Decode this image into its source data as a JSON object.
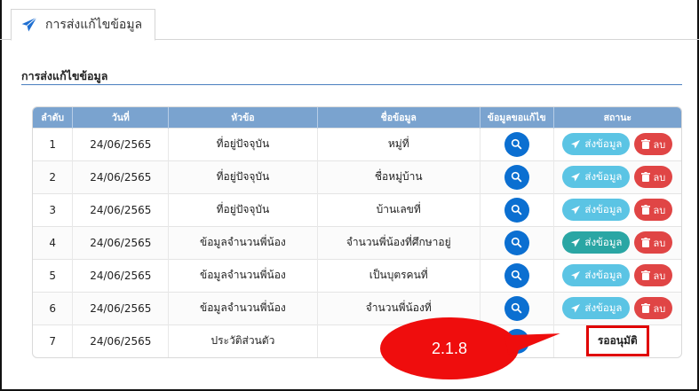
{
  "tab": {
    "label": "การส่งแก้ไขข้อมูล",
    "icon": "paper-plane-icon"
  },
  "section": {
    "title": "การส่งแก้ไขข้อมูล"
  },
  "table": {
    "headers": [
      "ลำดับ",
      "วันที่",
      "หัวข้อ",
      "ชื่อข้อมูล",
      "ข้อมูลขอแก้ไข",
      "สถานะ"
    ],
    "rows": [
      {
        "no": "1",
        "date": "24/06/2565",
        "topic": "ที่อยู่ปัจจุบัน",
        "field": "หมู่ที่"
      },
      {
        "no": "2",
        "date": "24/06/2565",
        "topic": "ที่อยู่ปัจจุบัน",
        "field": "ชื่อหมู่บ้าน"
      },
      {
        "no": "3",
        "date": "24/06/2565",
        "topic": "ที่อยู่ปัจจุบัน",
        "field": "บ้านเลขที่"
      },
      {
        "no": "4",
        "date": "24/06/2565",
        "topic": "ข้อมูลจำนวนพี่น้อง",
        "field": "จำนวนพี่น้องที่ศึกษาอยู่"
      },
      {
        "no": "5",
        "date": "24/06/2565",
        "topic": "ข้อมูลจำนวนพี่น้อง",
        "field": "เป็นบุตรคนที่"
      },
      {
        "no": "6",
        "date": "24/06/2565",
        "topic": "ข้อมูลจำนวนพี่น้อง",
        "field": "จำนวนพี่น้องที่"
      },
      {
        "no": "7",
        "date": "24/06/2565",
        "topic": "ประวัติส่วนตัว",
        "field": "",
        "status": "รออนุมัติ"
      }
    ],
    "send_label": "ส่งข้อมูล",
    "delete_label": "ลบ"
  },
  "callout": {
    "label": "2.1.8"
  },
  "colors": {
    "header_bg": "#7aa3cf",
    "search_btn": "#0b6fd1",
    "send_btn": "#5bc4e4",
    "send_btn_active": "#2aa6a4",
    "delete_btn": "#e04545",
    "highlight": "#e00000"
  }
}
